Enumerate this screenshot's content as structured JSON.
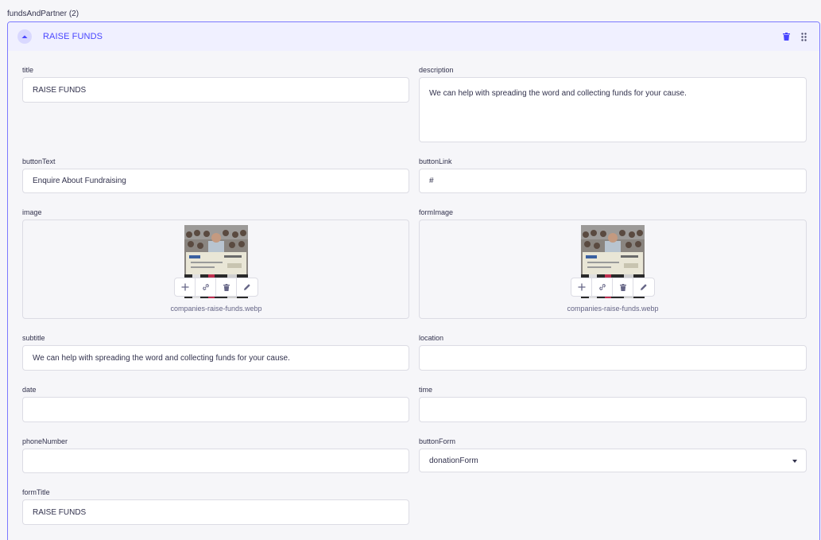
{
  "group": {
    "label": "fundsAndPartner (2)"
  },
  "card": {
    "title": "RAISE FUNDS"
  },
  "icons": {
    "toggle": "chevron-up-icon",
    "delete": "trash-icon",
    "drag": "drag-handle-icon",
    "add": "plus-icon",
    "link": "link-icon",
    "edit": "pencil-icon",
    "caret": "caret-down-icon"
  },
  "colors": {
    "accent": "#4945ff",
    "border_active": "#7b79ff",
    "header_bg": "#f0f0ff"
  },
  "fields": {
    "title": {
      "label": "title",
      "value": "RAISE FUNDS"
    },
    "description": {
      "label": "description",
      "value": "We can help with spreading the word and collecting funds for your cause."
    },
    "buttonText": {
      "label": "buttonText",
      "value": "Enquire About Fundraising"
    },
    "buttonLink": {
      "label": "buttonLink",
      "value": "#"
    },
    "image": {
      "label": "image",
      "file": "companies-raise-funds.webp"
    },
    "formImage": {
      "label": "formImage",
      "file": "companies-raise-funds.webp"
    },
    "subtitle": {
      "label": "subtitle",
      "value": "We can help with spreading the word and collecting funds for your cause."
    },
    "location": {
      "label": "location",
      "value": ""
    },
    "date": {
      "label": "date",
      "value": ""
    },
    "time": {
      "label": "time",
      "value": ""
    },
    "phoneNumber": {
      "label": "phoneNumber",
      "value": ""
    },
    "buttonForm": {
      "label": "buttonForm",
      "value": "donationForm"
    },
    "formTitle": {
      "label": "formTitle",
      "value": "RAISE FUNDS"
    }
  }
}
